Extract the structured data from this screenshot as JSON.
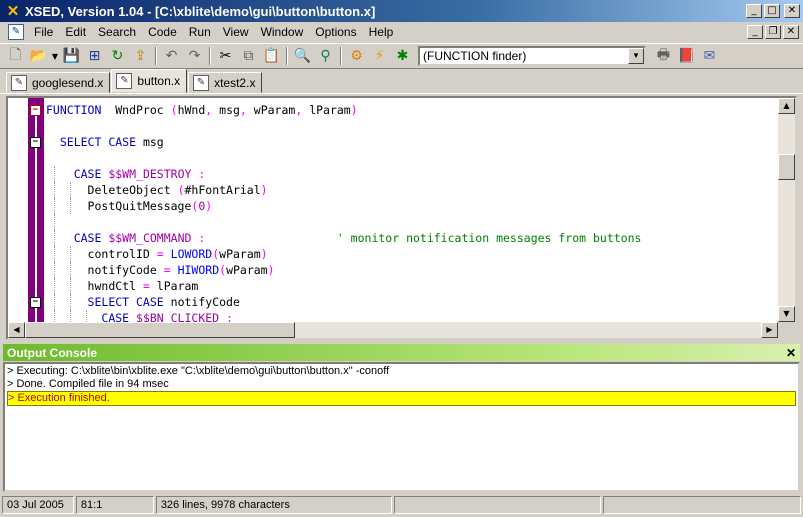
{
  "window": {
    "title": "XSED, Version 1.04 - [C:\\xblite\\demo\\gui\\button\\button.x]",
    "app_icon": "xsed-x-icon"
  },
  "menubar": {
    "items": [
      "File",
      "Edit",
      "Search",
      "Code",
      "Run",
      "View",
      "Window",
      "Options",
      "Help"
    ]
  },
  "toolbar": {
    "finder_value": "(FUNCTION finder)",
    "icons": [
      "new-file-icon",
      "open-folder-icon",
      "dropdown-arrow-icon",
      "save-icon",
      "save-all-icon",
      "refresh-icon",
      "export-icon",
      "undo-icon",
      "redo-icon",
      "cut-icon",
      "copy-icon",
      "paste-icon",
      "find-icon",
      "find-replace-icon",
      "compile-icon",
      "run-icon",
      "debug-icon",
      "print-icon",
      "help-book-icon",
      "mail-icon"
    ]
  },
  "tabs": [
    {
      "label": "googlesend.x",
      "active": false
    },
    {
      "label": "button.x",
      "active": true
    },
    {
      "label": "xtest2.x",
      "active": false
    }
  ],
  "editor": {
    "lines": [
      {
        "indent": 0,
        "fold": "minus-red",
        "tokens": [
          [
            "kw",
            "FUNCTION"
          ],
          [
            "id",
            "  WndProc "
          ],
          [
            "pun",
            "("
          ],
          [
            "id",
            "hWnd"
          ],
          [
            "pun",
            ", "
          ],
          [
            "id",
            "msg"
          ],
          [
            "pun",
            ", "
          ],
          [
            "id",
            "wParam"
          ],
          [
            "pun",
            ", "
          ],
          [
            "id",
            "lParam"
          ],
          [
            "pun",
            ")"
          ]
        ]
      },
      {
        "indent": 0,
        "tokens": []
      },
      {
        "indent": 2,
        "fold": "minus",
        "tokens": [
          [
            "kw",
            "SELECT CASE"
          ],
          [
            "id",
            " msg"
          ]
        ]
      },
      {
        "indent": 0,
        "tokens": []
      },
      {
        "indent": 4,
        "guides": [
          1
        ],
        "tokens": [
          [
            "kw",
            "CASE "
          ],
          [
            "cst",
            "$$WM_DESTROY"
          ],
          [
            "pun",
            " :"
          ]
        ]
      },
      {
        "indent": 6,
        "guides": [
          1,
          2
        ],
        "tokens": [
          [
            "id",
            "DeleteObject "
          ],
          [
            "pun",
            "("
          ],
          [
            "id",
            "#hFontArial"
          ],
          [
            "pun",
            ")"
          ]
        ]
      },
      {
        "indent": 6,
        "guides": [
          1,
          2
        ],
        "tokens": [
          [
            "id",
            "PostQuitMessage"
          ],
          [
            "pun",
            "("
          ],
          [
            "cst",
            "0"
          ],
          [
            "pun",
            ")"
          ]
        ]
      },
      {
        "indent": 0,
        "guides": [
          1
        ],
        "tokens": []
      },
      {
        "indent": 4,
        "guides": [
          1
        ],
        "tokens": [
          [
            "kw",
            "CASE "
          ],
          [
            "cst",
            "$$WM_COMMAND"
          ],
          [
            "pun",
            " :"
          ],
          [
            "cm",
            "                   ' monitor notification messages from buttons"
          ]
        ]
      },
      {
        "indent": 6,
        "guides": [
          1,
          2
        ],
        "tokens": [
          [
            "id",
            "controlID "
          ],
          [
            "pun",
            "= "
          ],
          [
            "fn",
            "LOWORD"
          ],
          [
            "pun",
            "("
          ],
          [
            "id",
            "wParam"
          ],
          [
            "pun",
            ")"
          ]
        ]
      },
      {
        "indent": 6,
        "guides": [
          1,
          2
        ],
        "tokens": [
          [
            "id",
            "notifyCode "
          ],
          [
            "pun",
            "= "
          ],
          [
            "fn",
            "HIWORD"
          ],
          [
            "pun",
            "("
          ],
          [
            "id",
            "wParam"
          ],
          [
            "pun",
            ")"
          ]
        ]
      },
      {
        "indent": 6,
        "guides": [
          1,
          2
        ],
        "tokens": [
          [
            "id",
            "hwndCtl "
          ],
          [
            "pun",
            "= "
          ],
          [
            "id",
            "lParam"
          ]
        ]
      },
      {
        "indent": 6,
        "guides": [
          1,
          2
        ],
        "fold": "minus",
        "tokens": [
          [
            "kw",
            "SELECT CASE"
          ],
          [
            "id",
            " notifyCode"
          ]
        ]
      },
      {
        "indent": 8,
        "guides": [
          1,
          2,
          3
        ],
        "tokens": [
          [
            "kw",
            "CASE "
          ],
          [
            "cst",
            "$$BN_CLICKED"
          ],
          [
            "pun",
            " :"
          ]
        ]
      }
    ]
  },
  "console": {
    "title": "Output Console",
    "close_label": "✕",
    "lines": [
      {
        "text": "> Executing: C:\\xblite\\bin\\xblite.exe \"C:\\xblite\\demo\\gui\\button\\button.x\" -conoff",
        "highlight": false
      },
      {
        "text": "> Done. Compiled file in 94 msec",
        "highlight": false
      },
      {
        "text": "> Execution finished.",
        "highlight": true
      }
    ]
  },
  "statusbar": {
    "date": "03 Jul 2005",
    "position": "81:1",
    "info": "326 lines, 9978 characters",
    "extra1": "",
    "extra2": ""
  },
  "colors": {
    "fold_margin": "#800080",
    "keyword": "#0000c0",
    "constant": "#a000a0",
    "comment": "#008000",
    "console_header": "#6dba2c",
    "console_highlight": "#ffff00"
  }
}
